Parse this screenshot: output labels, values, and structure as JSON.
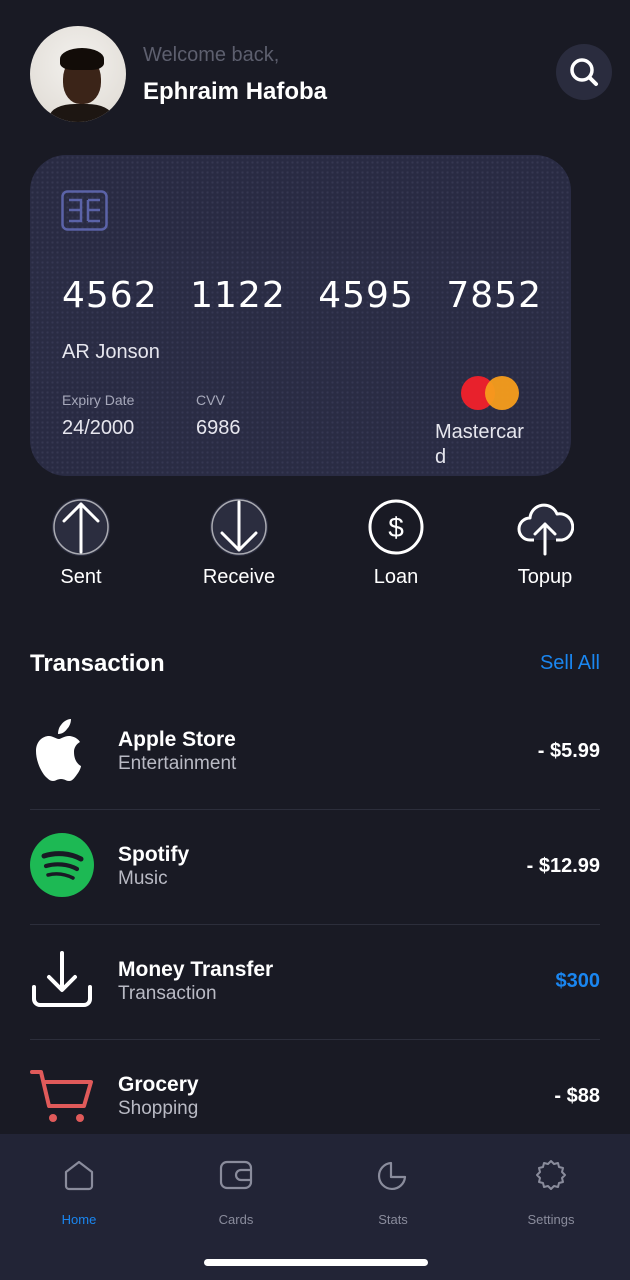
{
  "header": {
    "welcome": "Welcome back,",
    "username": "Ephraim Hafoba",
    "search_icon": "search-icon"
  },
  "card": {
    "number_groups": [
      "4562",
      "1122",
      "4595",
      "7852"
    ],
    "holder": "AR Jonson",
    "expiry_label": "Expiry Date",
    "expiry_value": "24/2000",
    "cvv_label": "CVV",
    "cvv_value": "6986",
    "brand": "Mastercard",
    "colors": {
      "bg": "#2a2c44",
      "mc_red": "#e8212c",
      "mc_orange": "#f79d1c"
    }
  },
  "actions": [
    {
      "label": "Sent",
      "icon": "arrow-up-icon"
    },
    {
      "label": "Receive",
      "icon": "arrow-down-icon"
    },
    {
      "label": "Loan",
      "icon": "dollar-icon"
    },
    {
      "label": "Topup",
      "icon": "cloud-upload-icon"
    }
  ],
  "transactions_section": {
    "title": "Transaction",
    "see_all": "Sell All"
  },
  "transactions": [
    {
      "name": "Apple Store",
      "category": "Entertainment",
      "amount": "- $5.99",
      "icon": "apple-icon"
    },
    {
      "name": "Spotify",
      "category": "Music",
      "amount": "- $12.99",
      "icon": "spotify-icon"
    },
    {
      "name": "Money Transfer",
      "category": "Transaction",
      "amount": "$300",
      "icon": "download-icon"
    },
    {
      "name": "Grocery",
      "category": "Shopping",
      "amount": "- $88",
      "icon": "cart-icon"
    }
  ],
  "tabbar": {
    "tabs": [
      {
        "label": "Home",
        "icon": "home-icon",
        "active": true
      },
      {
        "label": "Cards",
        "icon": "wallet-icon",
        "active": false
      },
      {
        "label": "Stats",
        "icon": "pie-chart-icon",
        "active": false
      },
      {
        "label": "Settings",
        "icon": "gear-icon",
        "active": false
      }
    ]
  },
  "colors": {
    "background": "#191a24",
    "accent": "#1a86f0",
    "tabbar": "#222436"
  }
}
